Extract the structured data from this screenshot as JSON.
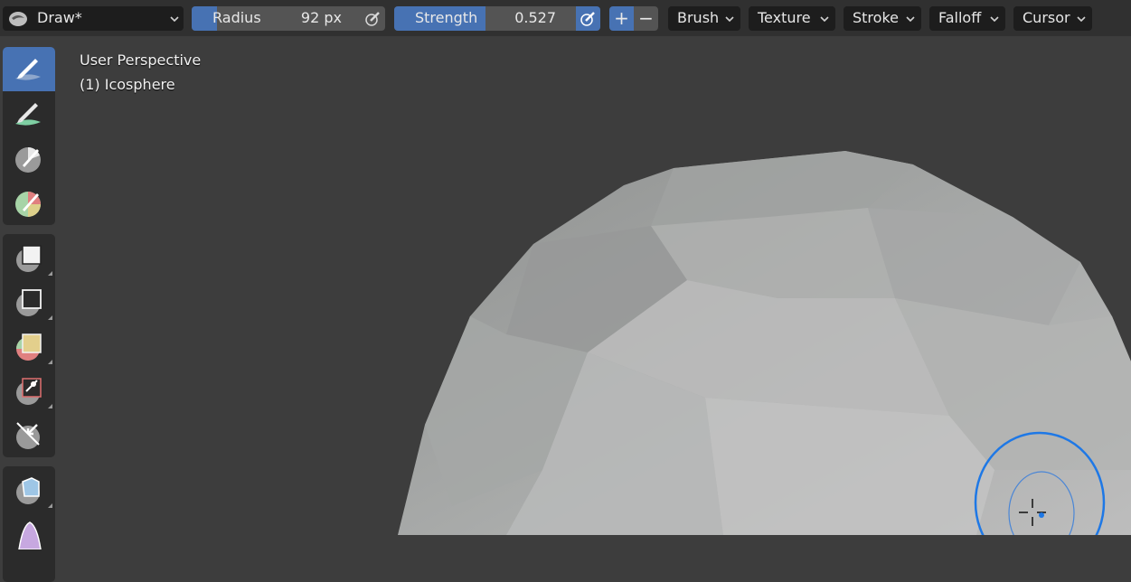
{
  "header": {
    "mode": {
      "name": "Draw*",
      "icon": "draw-brush-icon"
    },
    "radius": {
      "label": "Radius",
      "value": "92 px",
      "fill_fraction": 0.15
    },
    "strength": {
      "label": "Strength",
      "value": "0.527",
      "fill_fraction": 0.5
    },
    "direction": {
      "add": "+",
      "subtract": "−",
      "active": "add"
    },
    "menus": [
      "Brush",
      "Texture",
      "Stroke",
      "Falloff",
      "Cursor"
    ]
  },
  "toolbar": {
    "groups": [
      [
        "draw-brush-icon",
        "blur-brush-icon",
        "paint-brush-icon",
        "mask-brush-icon"
      ],
      [
        "box-face-set-icon",
        "box-mask-icon",
        "lasso-face-set-icon",
        "line-project-icon",
        "trim-icon"
      ],
      [
        "cloth-filter-icon",
        "color-filter-icon"
      ]
    ],
    "active": "draw-brush-icon"
  },
  "viewport": {
    "perspective": "User Perspective",
    "object": "(1) Icosphere"
  },
  "colors": {
    "accent": "#4772b3",
    "brush_circle": "#1e78e6",
    "background": "#3d3d3d",
    "header": "#303030"
  }
}
